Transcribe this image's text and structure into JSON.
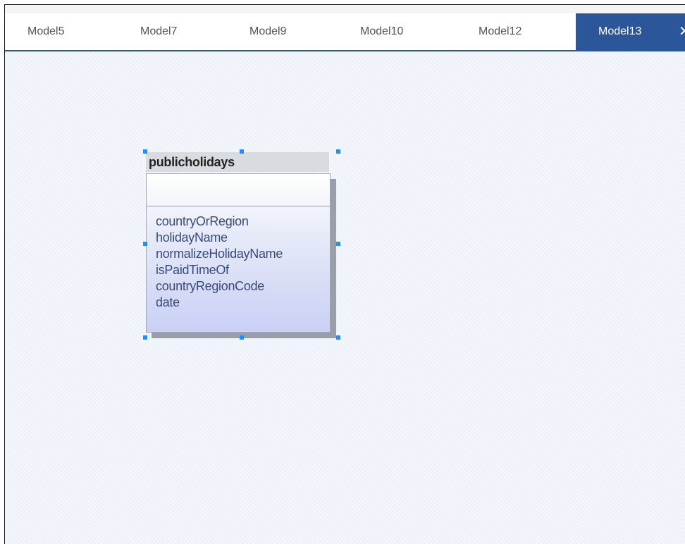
{
  "tabs": [
    {
      "label": "Model5",
      "active": false
    },
    {
      "label": "Model7",
      "active": false
    },
    {
      "label": "Model9",
      "active": false
    },
    {
      "label": "Model10",
      "active": false
    },
    {
      "label": "Model12",
      "active": false
    },
    {
      "label": "Model13",
      "active": true,
      "close_glyph": "✕"
    }
  ],
  "entity": {
    "title": "publicholidays",
    "attributes": [
      "countryOrRegion",
      "holidayName",
      "normalizeHolidayName",
      "isPaidTimeOf",
      "countryRegionCode",
      "date"
    ]
  },
  "colors": {
    "active_tab": "#2b579a",
    "selection_handle": "#1e90ff",
    "canvas": "#edf2f9"
  }
}
